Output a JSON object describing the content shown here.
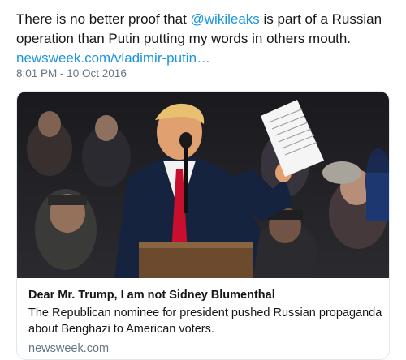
{
  "tweet": {
    "text_prefix": "There is no better proof that ",
    "mention": "@wikileaks",
    "text_middle": " is part of a Russian operation than Putin putting my words in others mouth.",
    "link": "newsweek.com/vladimir-putin…",
    "timestamp": "8:01 PM - 10 Oct 2016"
  },
  "card": {
    "title": "Dear Mr. Trump, I am not Sidney Blumenthal",
    "description": "The Republican nominee for president pushed Russian propaganda about Benghazi to American voters.",
    "domain": "newsweek.com"
  },
  "colors": {
    "link": "#1b95e0",
    "muted": "#657786",
    "border": "#e1e8ed"
  }
}
